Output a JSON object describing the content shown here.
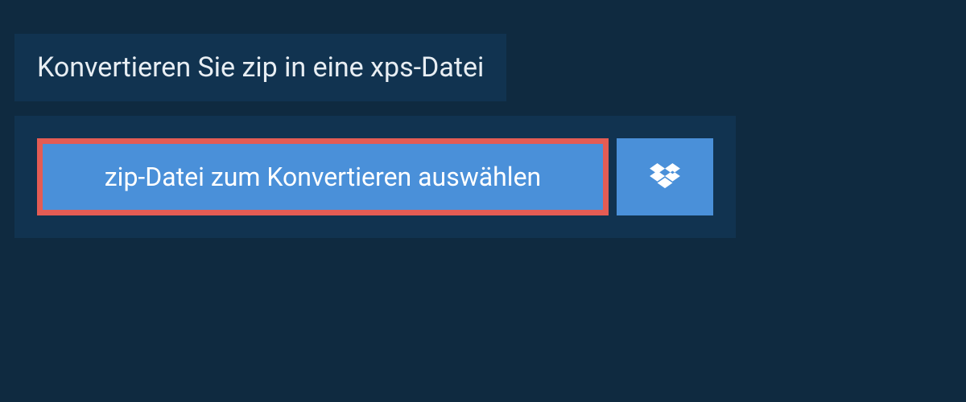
{
  "header": {
    "title": "Konvertieren Sie zip in eine xps-Datei"
  },
  "actions": {
    "selectFileLabel": "zip-Datei zum Konvertieren auswählen"
  }
}
